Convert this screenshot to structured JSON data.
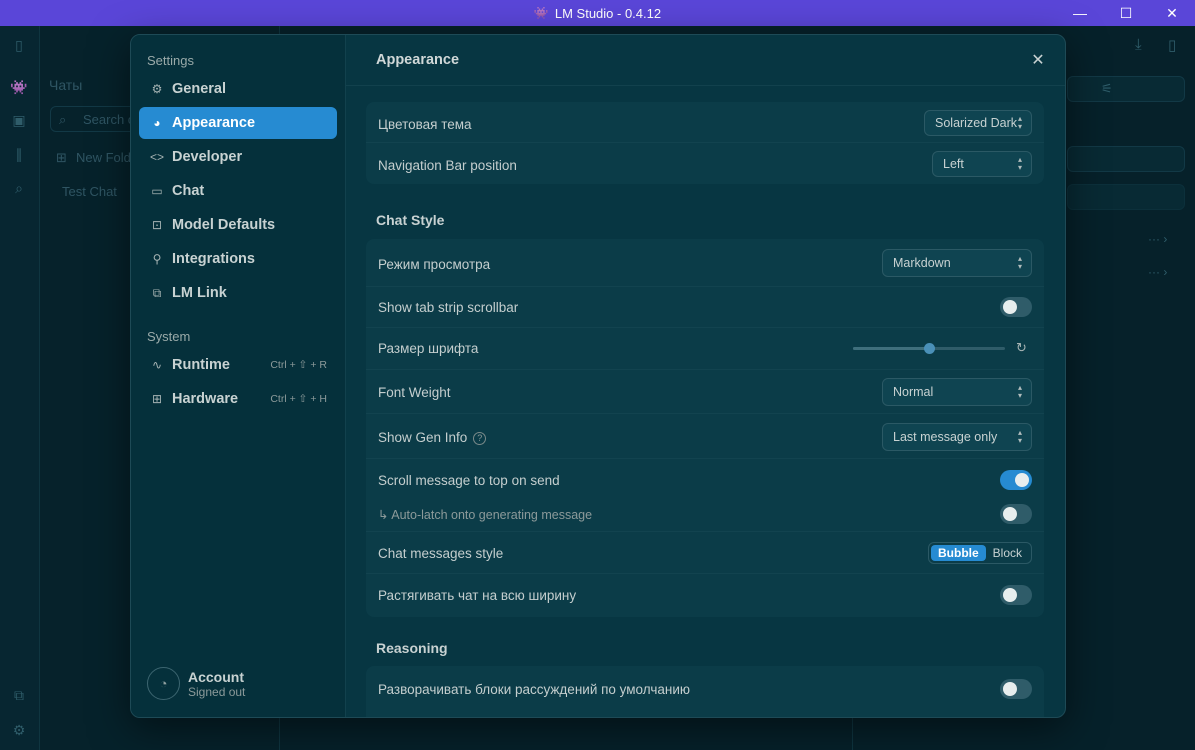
{
  "window": {
    "title": "LM Studio - 0.4.12",
    "controls": {
      "minimize": "—",
      "maximize": "☐",
      "close": "✕"
    }
  },
  "background": {
    "chats_title": "Чаты",
    "search_placeholder": "Search c",
    "new_folder": "New Folde",
    "test_chat": "Test Chat"
  },
  "sidebar": {
    "settings_heading": "Settings",
    "items": [
      {
        "label": "General",
        "icon": "gear-icon"
      },
      {
        "label": "Appearance",
        "icon": "palette-icon",
        "active": true
      },
      {
        "label": "Developer",
        "icon": "code-icon"
      },
      {
        "label": "Chat",
        "icon": "chat-bubble-icon"
      },
      {
        "label": "Model Defaults",
        "icon": "robot-icon"
      },
      {
        "label": "Integrations",
        "icon": "plug-icon"
      },
      {
        "label": "LM Link",
        "icon": "link-icon"
      }
    ],
    "system_heading": "System",
    "system_items": [
      {
        "label": "Runtime",
        "shortcut": "Ctrl + ⇧ + R",
        "icon": "pulse-icon"
      },
      {
        "label": "Hardware",
        "shortcut": "Ctrl + ⇧ + H",
        "icon": "chip-icon"
      }
    ],
    "account": {
      "name": "Account",
      "status": "Signed out"
    }
  },
  "content": {
    "title": "Appearance",
    "theme_card": {
      "color_theme_label": "Цветовая тема",
      "color_theme_value": "Solarized Dark",
      "nav_position_label": "Navigation Bar position",
      "nav_position_value": "Left"
    },
    "chat_style": {
      "heading": "Chat Style",
      "view_mode_label": "Режим просмотра",
      "view_mode_value": "Markdown",
      "tab_strip_label": "Show tab strip scrollbar",
      "tab_strip_on": false,
      "font_size_label": "Размер шрифта",
      "font_size_level": 0.5,
      "font_weight_label": "Font Weight",
      "font_weight_value": "Normal",
      "gen_info_label": "Show Gen Info",
      "gen_info_value": "Last message only",
      "scroll_top_label": "Scroll message to top on send",
      "scroll_top_on": true,
      "autolatch_label": "↳ Auto-latch onto generating message",
      "autolatch_on": false,
      "msg_style_label": "Chat messages style",
      "msg_style_options": [
        "Bubble",
        "Block"
      ],
      "msg_style_selected": "Bubble",
      "stretch_label": "Растягивать чат на всю ширину",
      "stretch_on": false
    },
    "reasoning": {
      "heading": "Reasoning",
      "expand_label": "Разворачивать блоки рассуждений по умолчанию",
      "expand_on": false
    }
  },
  "colors": {
    "accent": "#268bd2",
    "titlebar": "#5a46d8",
    "modal_bg": "#073642",
    "card_bg": "#0b3c48"
  }
}
